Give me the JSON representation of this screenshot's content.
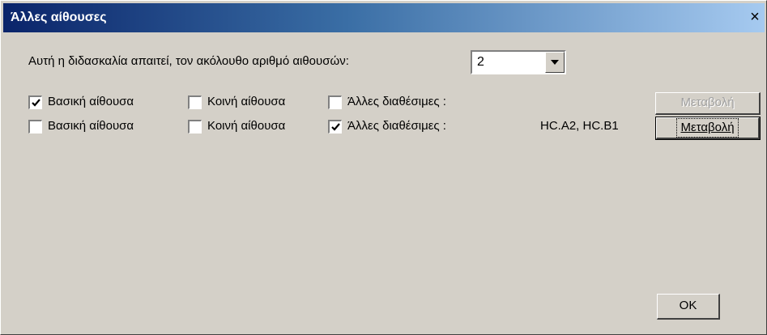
{
  "window": {
    "title": "Άλλες αίθουσες",
    "close_glyph": "×"
  },
  "prompt": {
    "text": "Αυτή η διδασκαλία απαιτεί, τον ακόλουθο αριθμό αιθουσών:",
    "room_count": "2"
  },
  "rows": [
    {
      "main_room": {
        "label": "Βασική αίθουσα",
        "checked": true
      },
      "shared_room": {
        "label": "Κοινή αίθουσα",
        "checked": false
      },
      "other_available": {
        "label": "Άλλες διαθέσιμες :",
        "checked": false
      },
      "selected_rooms": "",
      "change_button": {
        "label": "Μεταβολή",
        "enabled": false
      }
    },
    {
      "main_room": {
        "label": "Βασική αίθουσα",
        "checked": false
      },
      "shared_room": {
        "label": "Κοινή αίθουσα",
        "checked": false
      },
      "other_available": {
        "label": "Άλλες διαθέσιμες :",
        "checked": true
      },
      "selected_rooms": "HC.A2, HC.B1",
      "change_button": {
        "label": "Μεταβολή",
        "enabled": true
      }
    }
  ],
  "ok_button": {
    "label": "OK"
  },
  "colors": {
    "face": "#d4d0c8",
    "title_start": "#0a246a",
    "title_end": "#a6caf0"
  }
}
